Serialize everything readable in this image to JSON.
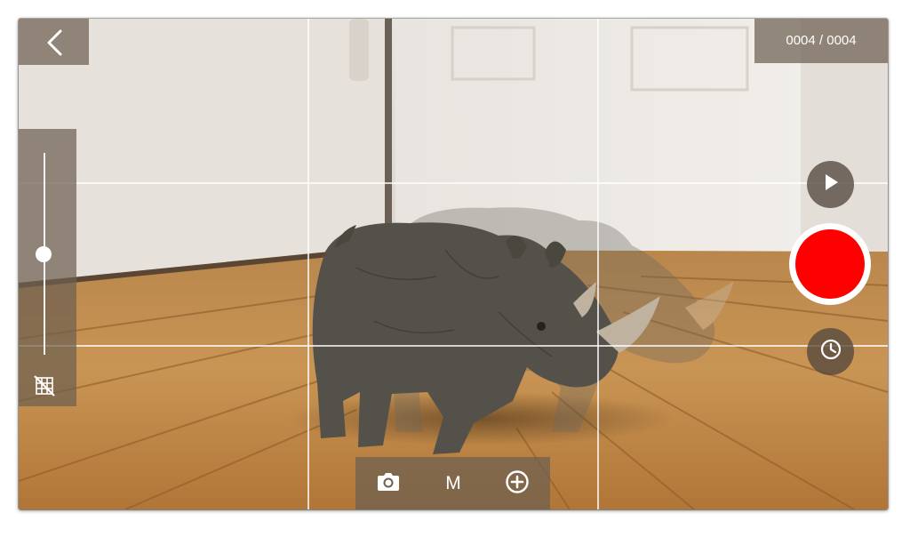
{
  "app": {
    "frame_counter": "0004 / 0004",
    "mode_label": "M"
  },
  "icons": {
    "back": "chevron-left-icon",
    "grid_toggle": "grid-off-icon",
    "camera": "camera-icon",
    "add": "plus-circle-icon",
    "play": "play-icon",
    "record": "record-icon",
    "timer": "clock-icon"
  },
  "controls": {
    "exposure_slider_level": 0.4
  },
  "colors": {
    "record": "#ff0000",
    "overlay_panel": "#6e5f50",
    "grid": "#ffffff"
  }
}
